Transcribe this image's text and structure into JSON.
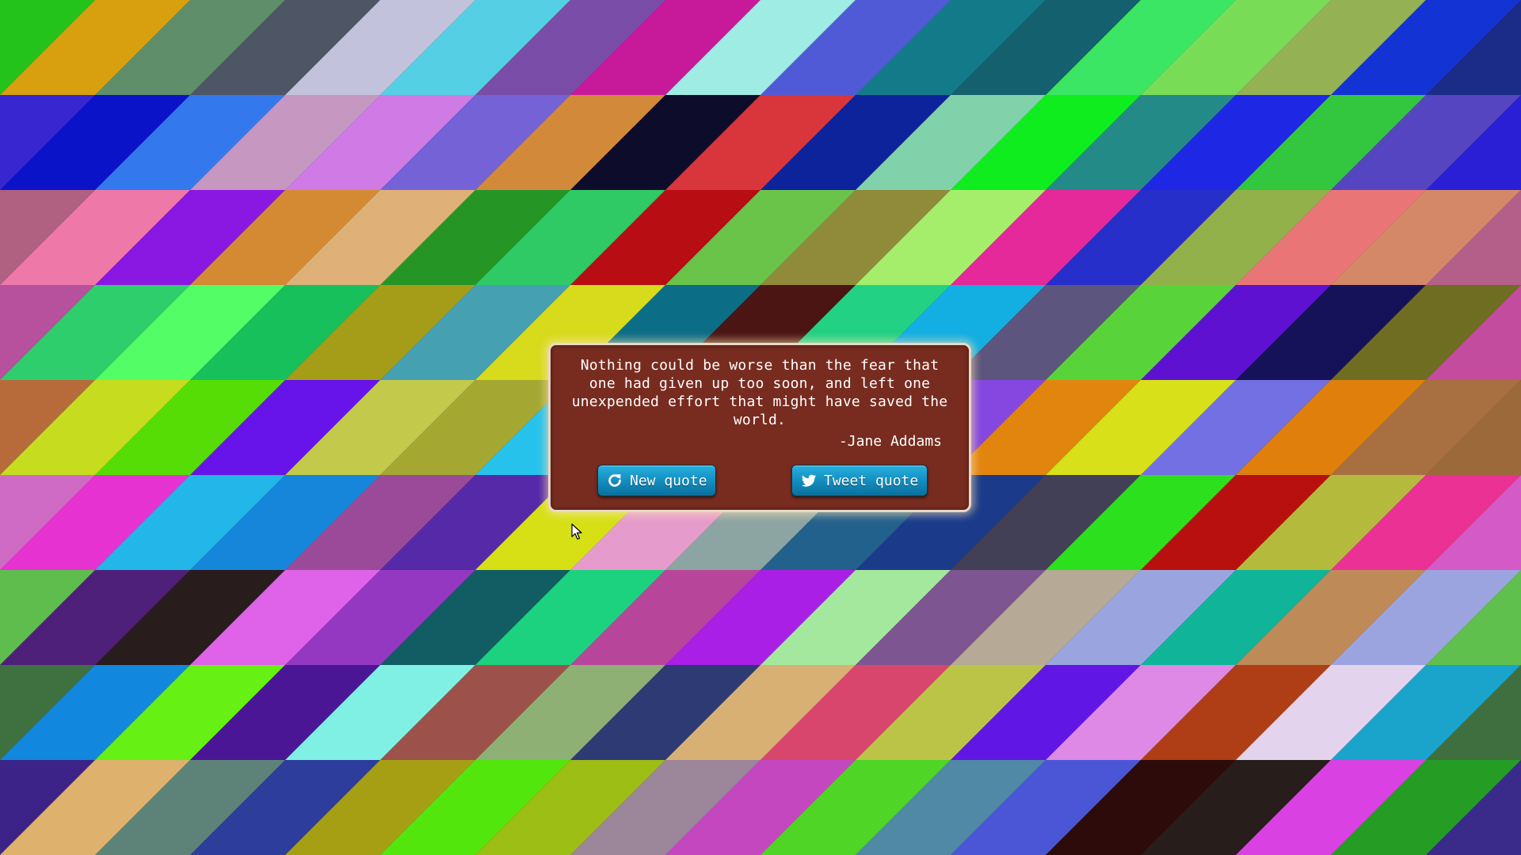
{
  "page": {
    "background_palette": [
      "#24c31c",
      "#d8a00e",
      "#5e8f6a",
      "#4e5565",
      "#c3c2dd",
      "#54cfe3",
      "#7a4ea8",
      "#c71a9b",
      "#9fece4",
      "#515ad6",
      "#137a8a",
      "#15606e",
      "#3ae663",
      "#79dc57",
      "#94b254",
      "#1433d4",
      "#1a2b88",
      "#22c531",
      "#3827d1",
      "#0b13c8",
      "#3478ee",
      "#c697c0",
      "#d07ae6",
      "#7462d6",
      "#d3893a",
      "#0e0c2b",
      "#d8363a",
      "#0c239c",
      "#81d1aa",
      "#10ed1e",
      "#238a87",
      "#1e27e4",
      "#32c73e",
      "#5645c0",
      "#2a1fd4",
      "#3a2fa8",
      "#b06080",
      "#ee78a8",
      "#8b17e2",
      "#d38a33",
      "#dfb178",
      "#259626",
      "#2fca66",
      "#b80e13",
      "#6ac44a",
      "#8f8b3b",
      "#a5ee6b",
      "#e5289a",
      "#272fcb",
      "#93b14a",
      "#ea7577",
      "#d48868",
      "#b35f8a",
      "#3a40c0",
      "#b7509d",
      "#2fce6d",
      "#53fd66",
      "#17c05a",
      "#a59d18",
      "#45a0b1",
      "#d7db1c",
      "#0c6d87",
      "#4a1512",
      "#22d184",
      "#13aee2",
      "#5c557d",
      "#58d43a",
      "#5e11d1",
      "#15125a",
      "#6f6d21",
      "#c44c9e",
      "#b04a70",
      "#b76b3a",
      "#c5dc1f",
      "#55dd05",
      "#6614e9",
      "#c2c94b",
      "#a4a832",
      "#27c2ec",
      "#3e8c95",
      "#4e3b2b",
      "#cb1113",
      "#8547df",
      "#e2850f",
      "#d7e018",
      "#7270e2",
      "#e07f0c",
      "#a87040",
      "#9c6a3a",
      "#b86030",
      "#d06bc5",
      "#e632d1",
      "#22b6e9",
      "#1686db",
      "#9a4a98",
      "#5529a7",
      "#d6e015",
      "#e59bcc",
      "#8da5a2",
      "#23618d",
      "#1b3b8a",
      "#424057",
      "#2de01d",
      "#b8100f",
      "#b4bb3c",
      "#ec3194",
      "#d45bc7",
      "#c040a0",
      "#5fbd4d",
      "#4e207a",
      "#281c1c",
      "#de63e8",
      "#9438c2",
      "#115d63",
      "#1dd27e",
      "#b7469b",
      "#aa1fe5",
      "#a3e89d",
      "#7d5591",
      "#b6a995",
      "#9aa5e0",
      "#10b499",
      "#be8a58",
      "#9ca4e0",
      "#5fc04e",
      "#4a9a50",
      "#3f703f",
      "#1188dd",
      "#67f014",
      "#4a1696",
      "#80f0e4",
      "#9c524a",
      "#8fb074",
      "#2d3a74",
      "#d8b073",
      "#d8456d",
      "#bcc447",
      "#6016e5",
      "#de89e6",
      "#af3d16",
      "#e3d3ec",
      "#1aa3cb",
      "#3f6f3f",
      "#3a6a40",
      "#3b2388",
      "#deb16d",
      "#5d8379",
      "#2c3d9c",
      "#a69f14",
      "#52e60d",
      "#9dbe15",
      "#9b869a",
      "#c547c0",
      "#4fd525",
      "#4f89a6",
      "#4a56d5",
      "#2d0b0a",
      "#271d1a",
      "#da41e3",
      "#259c24",
      "#3a2a8a",
      "#30208a"
    ]
  },
  "quote": {
    "text": "Nothing could be worse than the fear that one had given up too soon, and left one unexpended effort that might have saved the world.",
    "author": "-Jane Addams",
    "box_color": "#772c1f",
    "border_color": "#e9d8c7"
  },
  "buttons": {
    "new_quote": {
      "label": "New quote",
      "icon": "refresh-icon"
    },
    "tweet_quote": {
      "label": "Tweet quote",
      "icon": "twitter-bird-icon"
    },
    "accent": "#1592c4"
  }
}
